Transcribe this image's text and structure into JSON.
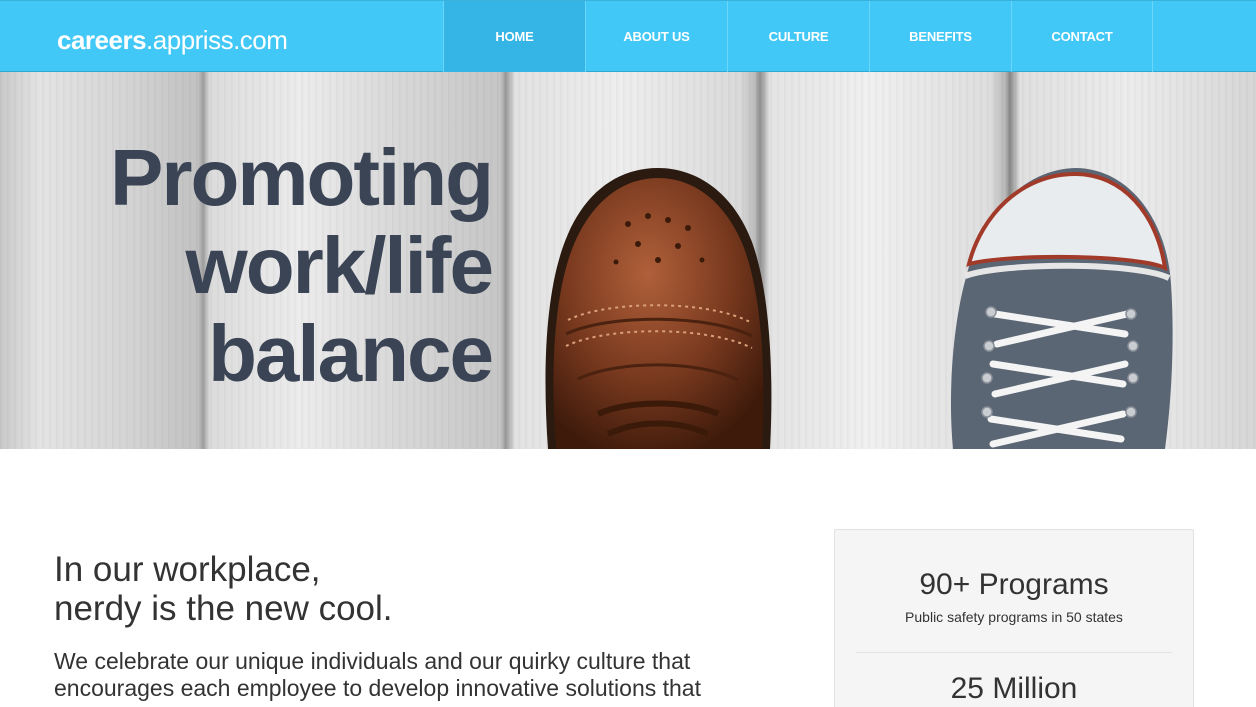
{
  "header": {
    "logo_strong": "careers",
    "logo_light": ".appriss.com",
    "nav": [
      {
        "label": "HOME",
        "active": true
      },
      {
        "label": "ABOUT US",
        "active": false
      },
      {
        "label": "CULTURE",
        "active": false
      },
      {
        "label": "BENEFITS",
        "active": false
      },
      {
        "label": "CONTACT",
        "active": false
      }
    ]
  },
  "hero": {
    "heading_lines": [
      "Promoting",
      "work/life",
      "balance"
    ]
  },
  "content": {
    "heading_lines": [
      "In our workplace,",
      "nerdy is the new cool."
    ],
    "body": "We celebrate our unique individuals and our quirky culture that encourages each employee to develop innovative solutions that"
  },
  "stats": [
    {
      "value": "90+ Programs",
      "caption": "Public safety programs in 50 states"
    },
    {
      "value": "25 Million",
      "caption": ""
    }
  ],
  "colors": {
    "header_bg": "#42c8f6",
    "nav_active_bg": "#35b5e6",
    "hero_text": "#3a4455"
  }
}
